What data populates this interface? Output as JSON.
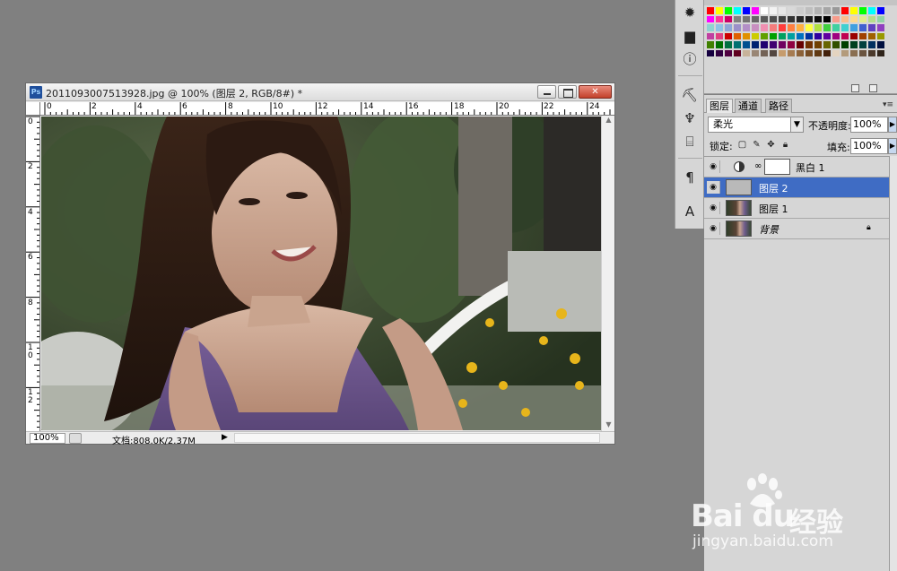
{
  "document": {
    "title": "2011093007513928.jpg @ 100% (图层 2, RGB/8#) *",
    "ps_icon": "Ps",
    "zoom": "100%",
    "doc_size": "文档:808.0K/2.37M",
    "h_ruler": [
      "0",
      "2",
      "4",
      "6",
      "8",
      "10",
      "12",
      "14",
      "16",
      "18",
      "20",
      "22",
      "24"
    ],
    "v_ruler": [
      "0",
      "2",
      "4",
      "6",
      "8",
      "10",
      "12"
    ]
  },
  "layers_panel": {
    "tabs": [
      "图层",
      "通道",
      "路径"
    ],
    "active_tab": "图层",
    "blend_mode": "柔光",
    "opacity_label": "不透明度:",
    "opacity": "100%",
    "lock_label": "锁定:",
    "fill_label": "填充:",
    "fill": "100%",
    "layers": [
      {
        "name": "黑白 1",
        "type": "adjustment",
        "selected": false
      },
      {
        "name": "图层 2",
        "type": "gray",
        "selected": true
      },
      {
        "name": "图层 1",
        "type": "photo",
        "selected": false
      },
      {
        "name": "背景",
        "type": "photo",
        "selected": false,
        "locked": true
      }
    ]
  },
  "swatches": {
    "colors": [
      "#ff0000",
      "#ffff00",
      "#00ff00",
      "#00ffff",
      "#0000ff",
      "#ff00ff",
      "#ffffff",
      "#f2f2f2",
      "#e6e6e6",
      "#d9d9d9",
      "#cccccc",
      "#bfbfbf",
      "#b3b3b3",
      "#a6a6a6",
      "#999999",
      "#ff0000",
      "#ffff00",
      "#00ff00",
      "#00ffff",
      "#0000ff",
      "#ff00ff",
      "#ff3399",
      "#cc0066",
      "#808080",
      "#737373",
      "#666666",
      "#595959",
      "#4d4d4d",
      "#404040",
      "#333333",
      "#262626",
      "#1a1a1a",
      "#0d0d0d",
      "#000000",
      "#f79c8c",
      "#f9bf8f",
      "#fcd98f",
      "#e1eb8c",
      "#b6dc8c",
      "#92d2a7",
      "#8fd4d2",
      "#8ec3e6",
      "#8ea7d8",
      "#9c90c9",
      "#b38fc7",
      "#c88fc0",
      "#f08fb1",
      "#f47c7c",
      "#ff3c3c",
      "#ff8040",
      "#ffb040",
      "#ffff40",
      "#b0e040",
      "#40d040",
      "#40d0a0",
      "#40d0d0",
      "#40a0e0",
      "#4060d0",
      "#6040c0",
      "#9040c0",
      "#c040a0",
      "#e04080",
      "#cc0000",
      "#e06000",
      "#e09000",
      "#cccc00",
      "#60a000",
      "#00a000",
      "#00a060",
      "#00a0a0",
      "#0070c0",
      "#0030a0",
      "#3000a0",
      "#6000a0",
      "#a00080",
      "#c00050",
      "#990000",
      "#a04000",
      "#a06000",
      "#999900",
      "#408000",
      "#007000",
      "#007040",
      "#007070",
      "#005090",
      "#002070",
      "#200070",
      "#400070",
      "#700060",
      "#900040",
      "#660000",
      "#703000",
      "#704000",
      "#666600",
      "#305000",
      "#004000",
      "#004020",
      "#004040",
      "#003060",
      "#001040",
      "#150040",
      "#300040",
      "#500040",
      "#600020",
      "#c7b299",
      "#998675",
      "#736357",
      "#534741",
      "#c69c6d",
      "#a67c52",
      "#8c6239",
      "#754c24",
      "#603913",
      "#42210b",
      "#e4d4c0",
      "#b39b7c",
      "#8a6f52",
      "#6a5440",
      "#4b3a2c",
      "#2f241b"
    ]
  },
  "watermark": {
    "logo": "Bai du",
    "cn": "经验",
    "url": "jingyan.baidu.com"
  }
}
